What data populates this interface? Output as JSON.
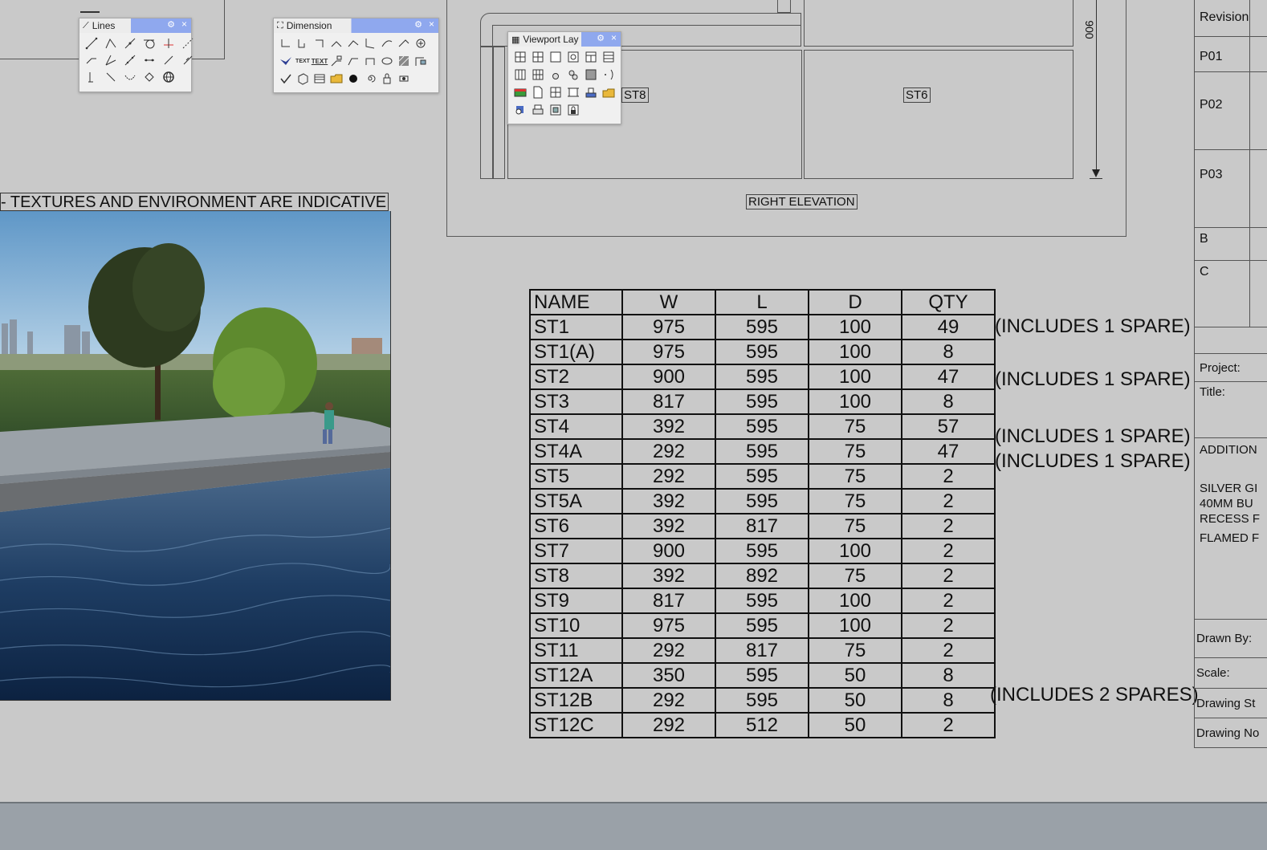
{
  "toolbars": {
    "lines": {
      "title": "Lines"
    },
    "dimension": {
      "title": "Dimension",
      "text_icon_a": "TEXT",
      "text_icon_b": "TEXT"
    },
    "viewport": {
      "title": "Viewport Lay"
    }
  },
  "elevation": {
    "label_st8": "ST8",
    "label_st6": "ST6",
    "title": "RIGHT ELEVATION",
    "dimension": "900"
  },
  "render": {
    "caption": "- TEXTURES AND ENVIRONMENT ARE INDICATIVE"
  },
  "schedule": {
    "headers": [
      "NAME",
      "W",
      "L",
      "D",
      "QTY"
    ],
    "rows": [
      [
        "ST1",
        "975",
        "595",
        "100",
        "49"
      ],
      [
        "ST1(A)",
        "975",
        "595",
        "100",
        "8"
      ],
      [
        "ST2",
        "900",
        "595",
        "100",
        "47"
      ],
      [
        "ST3",
        "817",
        "595",
        "100",
        "8"
      ],
      [
        "ST4",
        "392",
        "595",
        "75",
        "57"
      ],
      [
        "ST4A",
        "292",
        "595",
        "75",
        "47"
      ],
      [
        "ST5",
        "292",
        "595",
        "75",
        "2"
      ],
      [
        "ST5A",
        "392",
        "595",
        "75",
        "2"
      ],
      [
        "ST6",
        "392",
        "817",
        "75",
        "2"
      ],
      [
        "ST7",
        "900",
        "595",
        "100",
        "2"
      ],
      [
        "ST8",
        "392",
        "892",
        "75",
        "2"
      ],
      [
        "ST9",
        "817",
        "595",
        "100",
        "2"
      ],
      [
        "ST10",
        "975",
        "595",
        "100",
        "2"
      ],
      [
        "ST11",
        "292",
        "817",
        "75",
        "2"
      ],
      [
        "ST12A",
        "350",
        "595",
        "50",
        "8"
      ],
      [
        "ST12B",
        "292",
        "595",
        "50",
        "8"
      ],
      [
        "ST12C",
        "292",
        "512",
        "50",
        "2"
      ]
    ],
    "notes": {
      "st1": "(INCLUDES 1 SPARE)",
      "st2": "(INCLUDES 1 SPARE)",
      "st4": "(INCLUDES 1 SPARE)",
      "st4a": "(INCLUDES 1 SPARE)",
      "st12a": "(INCLUDES 2 SPARES)"
    }
  },
  "title_block": {
    "revision": "Revision",
    "p01": "P01",
    "p02": "P02",
    "p03": "P03",
    "b": "B",
    "c": "C",
    "project": "Project:",
    "title": "Title:",
    "addition": "ADDITION",
    "spec_1": "SILVER GI",
    "spec_2": "40MM BU",
    "spec_3": "RECESS F",
    "spec_4": "FLAMED F",
    "drawn_by": "Drawn By:",
    "scale": "Scale:",
    "drawing_status": "Drawing St",
    "drawing_no": "Drawing No"
  }
}
